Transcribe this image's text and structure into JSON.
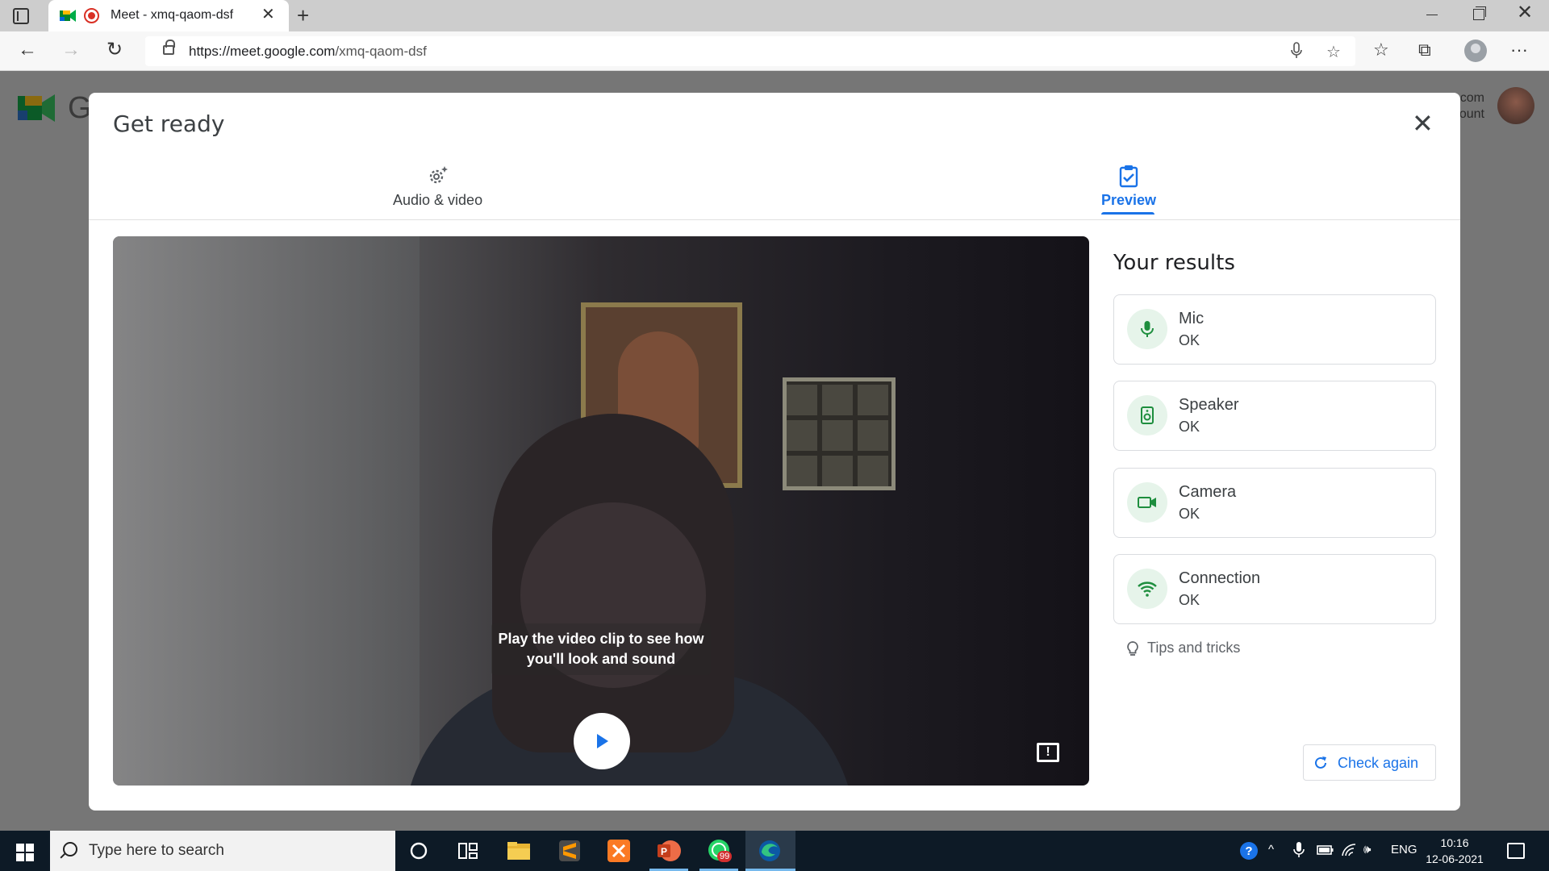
{
  "browser": {
    "tab_title": "Meet - xmq-qaom-dsf",
    "url_host": "https://meet.google.com",
    "url_path": "/xmq-qaom-dsf"
  },
  "background": {
    "logo_letter": "G",
    "account_line1": "com",
    "account_line2": "ount"
  },
  "dialog": {
    "title": "Get ready",
    "tabs": [
      {
        "label": "Audio & video",
        "active": false
      },
      {
        "label": "Preview",
        "active": true
      }
    ],
    "video_caption": "Play the video clip to see how you'll look and sound",
    "results_title": "Your results",
    "results": [
      {
        "name": "Mic",
        "status": "OK",
        "icon": "mic-icon"
      },
      {
        "name": "Speaker",
        "status": "OK",
        "icon": "speaker-icon"
      },
      {
        "name": "Camera",
        "status": "OK",
        "icon": "camera-icon"
      },
      {
        "name": "Connection",
        "status": "OK",
        "icon": "wifi-icon"
      }
    ],
    "tips_label": "Tips and tricks",
    "check_again_label": "Check again"
  },
  "taskbar": {
    "search_placeholder": "Type here to search",
    "whatsapp_badge": "99",
    "language": "ENG",
    "time": "10:16",
    "date": "12-06-2021"
  },
  "colors": {
    "accent": "#1a73e8",
    "ok_green": "#1e8e3e",
    "ok_bg": "#e6f4ea"
  }
}
